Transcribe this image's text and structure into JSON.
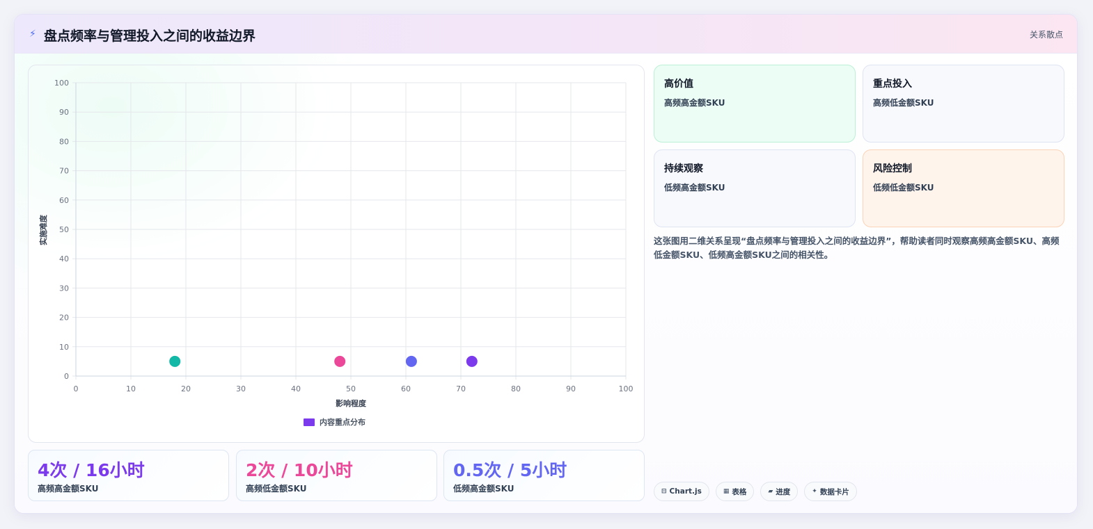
{
  "header": {
    "title": "盘点频率与管理投入之间的收益边界",
    "tag": "关系散点",
    "icon": "bolt-icon"
  },
  "chart_data": {
    "type": "scatter",
    "xlabel": "影响程度",
    "ylabel": "实施难度",
    "xlim": [
      0,
      100
    ],
    "ylim": [
      0,
      100
    ],
    "x_ticks": [
      0,
      10,
      20,
      30,
      40,
      50,
      60,
      70,
      80,
      90,
      100
    ],
    "y_ticks": [
      0,
      10,
      20,
      30,
      40,
      50,
      60,
      70,
      80,
      90,
      100
    ],
    "grid": true,
    "legend": {
      "position": "bottom",
      "entries": [
        "内容重点分布"
      ],
      "swatch_color": "#7c3aed"
    },
    "series": [
      {
        "name": "内容重点分布",
        "points": [
          {
            "x": 18,
            "y": 5,
            "color": "#14b8a6"
          },
          {
            "x": 48,
            "y": 5,
            "color": "#ec4899"
          },
          {
            "x": 61,
            "y": 5,
            "color": "#6366f1"
          },
          {
            "x": 72,
            "y": 5,
            "color": "#7c3aed"
          }
        ]
      }
    ]
  },
  "stats": [
    {
      "value": "4次 / 16小时",
      "label": "高频高金额SKU",
      "color": "#7c3aed"
    },
    {
      "value": "2次 / 10小时",
      "label": "高频低金额SKU",
      "color": "#ec4899"
    },
    {
      "value": "0.5次 / 5小时",
      "label": "低频高金额SKU",
      "color": "#6366f1"
    }
  ],
  "quadrants": [
    {
      "title": "高价值",
      "subtitle": "高频高金额SKU",
      "bg": "#ecfdf5",
      "border": "#bbf0d6"
    },
    {
      "title": "重点投入",
      "subtitle": "高频低金额SKU",
      "bg": "#f8f9fd",
      "border": "#dfe4f3"
    },
    {
      "title": "持续观察",
      "subtitle": "低频高金额SKU",
      "bg": "#f8f9fd",
      "border": "#dfe4f3"
    },
    {
      "title": "风险控制",
      "subtitle": "低频低金额SKU",
      "bg": "#fff4ec",
      "border": "#fbd3b6"
    }
  ],
  "description": "这张图用二维关系呈现“盘点频率与管理投入之间的收益边界”，帮助读者同时观察高频高金额SKU、高频低金额SKU、低频高金额SKU之间的相关性。",
  "chips": [
    {
      "icon": "⊟",
      "icon_name": "chart-icon",
      "label": "Chart.js"
    },
    {
      "icon": "▦",
      "icon_name": "table-icon",
      "label": "表格"
    },
    {
      "icon": "▰",
      "icon_name": "progress-icon",
      "label": "进度"
    },
    {
      "icon": "✦",
      "icon_name": "sparkle-icon",
      "label": "数据卡片"
    }
  ]
}
